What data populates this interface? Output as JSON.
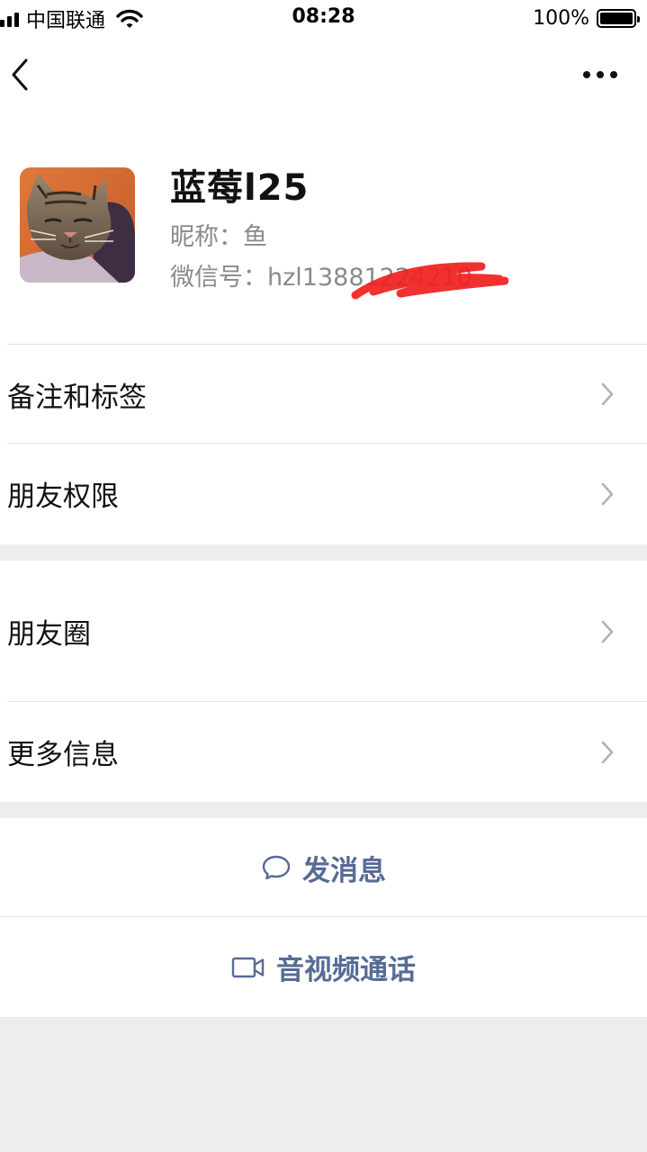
{
  "status_bar": {
    "carrier": "中国联通",
    "time": "08:28",
    "battery": "100%",
    "battery_level": 1.0
  },
  "nav": {
    "back_icon": "chevron-left-icon",
    "more_icon": "more-horizontal-icon"
  },
  "profile": {
    "display_name": "蓝莓l25",
    "nickname": "昵称：鱼",
    "wechat_id": "微信号：hzl13881224210"
  },
  "menu_group_1": {
    "items": [
      {
        "label": "备注和标签"
      },
      {
        "label": "朋友权限"
      }
    ]
  },
  "menu_group_2": {
    "items": [
      {
        "label": "朋友圈"
      },
      {
        "label": "更多信息"
      }
    ]
  },
  "actions": {
    "send_message": "发消息",
    "video_call": "音视频通话"
  },
  "colors": {
    "link": "#576b95",
    "background": "#ededed",
    "redaction": "#f01e1e"
  }
}
